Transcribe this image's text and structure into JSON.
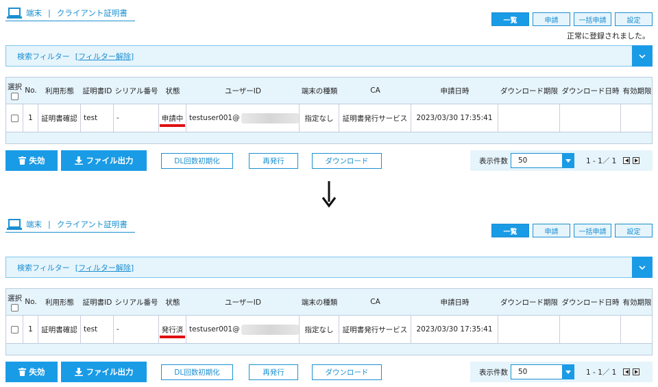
{
  "panels": [
    {
      "header": {
        "device": "端末",
        "separator": "|",
        "page": "クライアント証明書"
      },
      "tabs": [
        "一覧",
        "申請",
        "一括申請",
        "設定"
      ],
      "message": "正常に登録されました。",
      "filter": {
        "label": "検索フィルター",
        "clear": "[フィルター解除]"
      },
      "columns": [
        "選択",
        "No.",
        "利用形態",
        "証明書ID",
        "シリアル番号",
        "状態",
        "ユーザーID",
        "端末の種類",
        "CA",
        "申請日時",
        "ダウンロード期限",
        "ダウンロード日時",
        "有効期限"
      ],
      "row": {
        "no": "1",
        "usage": "証明書確認",
        "cert_id": "test",
        "serial": "-",
        "status": "申請中",
        "user_id": "testuser001@",
        "device_type": "指定なし",
        "ca": "証明書発行サービス",
        "applied_at": "2023/03/30 17:35:41",
        "dl_limit": "",
        "dl_at": "",
        "expires": ""
      },
      "actions": {
        "revoke": "失効",
        "export": "ファイル出力",
        "reset_dl": "DL回数初期化",
        "reissue": "再発行",
        "download": "ダウンロード"
      },
      "pager": {
        "label": "表示件数",
        "per_page": "50",
        "range": "1 - 1／ 1"
      }
    },
    {
      "header": {
        "device": "端末",
        "separator": "|",
        "page": "クライアント証明書"
      },
      "tabs": [
        "一覧",
        "申請",
        "一括申請",
        "設定"
      ],
      "message": "",
      "filter": {
        "label": "検索フィルター",
        "clear": "[フィルター解除]"
      },
      "columns": [
        "選択",
        "No.",
        "利用形態",
        "証明書ID",
        "シリアル番号",
        "状態",
        "ユーザーID",
        "端末の種類",
        "CA",
        "申請日時",
        "ダウンロード期限",
        "ダウンロード日時",
        "有効期限"
      ],
      "row": {
        "no": "1",
        "usage": "証明書確認",
        "cert_id": "test",
        "serial": "-",
        "status": "発行済",
        "user_id": "testuser001@",
        "device_type": "指定なし",
        "ca": "証明書発行サービス",
        "applied_at": "2023/03/30 17:35:41",
        "dl_limit": "",
        "dl_at": "",
        "expires": ""
      },
      "actions": {
        "revoke": "失効",
        "export": "ファイル出力",
        "reset_dl": "DL回数初期化",
        "reissue": "再発行",
        "download": "ダウンロード"
      },
      "pager": {
        "label": "表示件数",
        "per_page": "50",
        "range": "1 - 1／ 1"
      }
    }
  ],
  "icons": {
    "header": "laptop-icon",
    "revoke": "trash-icon",
    "export": "download-icon",
    "filter_toggle": "chevron-down-icon",
    "transition": "down-arrow-icon"
  },
  "colors": {
    "accent": "#1a9be6",
    "panel_bg": "#e6f4fc",
    "highlight": "#e01010"
  }
}
